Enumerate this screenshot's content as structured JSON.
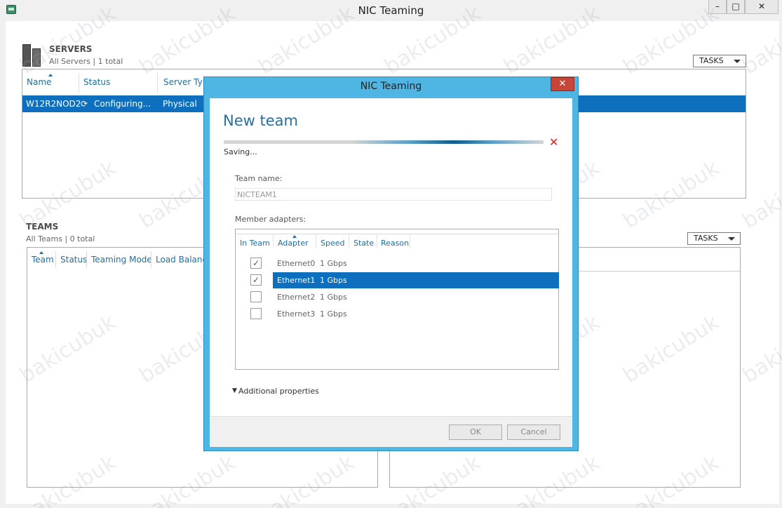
{
  "window": {
    "title": "NIC Teaming",
    "minimize": "–",
    "maximize": "□",
    "close": "✕"
  },
  "servers": {
    "title": "SERVERS",
    "subtitle": "All Servers | 1 total",
    "tasks_label": "TASKS",
    "columns": [
      "Name",
      "Status",
      "Server Type"
    ],
    "row": {
      "name": "W12R2NOD2",
      "status": "Configuring...",
      "type": "Physical"
    }
  },
  "teams": {
    "title": "TEAMS",
    "subtitle": "All Teams | 0 total",
    "tasks_label": "TASKS",
    "columns": [
      "Team",
      "Status",
      "Teaming Mode",
      "Load Balancing"
    ]
  },
  "dialog": {
    "title": "NIC Teaming",
    "close": "✕",
    "heading": "New team",
    "progress_fraction": 0.6,
    "status": "Saving...",
    "cancel_icon": "✕",
    "team_name_label": "Team name:",
    "team_name_value": "NICTEAM1",
    "member_label": "Member adapters:",
    "adapter_columns": [
      "In Team",
      "Adapter",
      "Speed",
      "State",
      "Reason"
    ],
    "adapters": [
      {
        "name": "Ethernet0",
        "speed": "1 Gbps",
        "checked": true,
        "selected": false
      },
      {
        "name": "Ethernet1",
        "speed": "1 Gbps",
        "checked": true,
        "selected": true
      },
      {
        "name": "Ethernet2",
        "speed": "1 Gbps",
        "checked": false,
        "selected": false
      },
      {
        "name": "Ethernet3",
        "speed": "1 Gbps",
        "checked": false,
        "selected": false
      }
    ],
    "additional_properties": "Additional properties",
    "ok": "OK",
    "cancel": "Cancel"
  },
  "watermark": "bakicubuk",
  "colors": {
    "selection": "#0e6fbf",
    "dialog_frame": "#4fb6e3",
    "heading": "#2a6e9e",
    "close_red": "#c7463a"
  }
}
